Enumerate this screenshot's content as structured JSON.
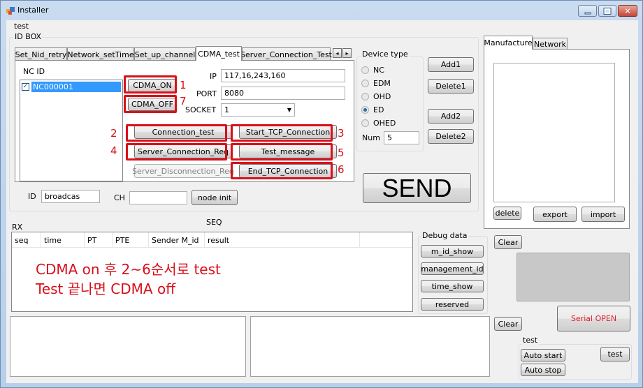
{
  "window": {
    "title": "Installer",
    "menu_label": "test"
  },
  "id_box": {
    "title": "ID BOX",
    "tabs": [
      {
        "label": "Set_Nid_retry",
        "active": false
      },
      {
        "label": "Network_setTime",
        "active": false
      },
      {
        "label": "Set_up_channel",
        "active": false
      },
      {
        "label": "CDMA_test",
        "active": true
      },
      {
        "label": "Server_Connection_Test",
        "active": false
      }
    ],
    "tab_scroll": {
      "left": "◂",
      "right": "▸"
    },
    "nc_id": {
      "label": "NC ID",
      "items": [
        {
          "label": "NC000001",
          "checked": true,
          "selected": true
        }
      ]
    },
    "cdma": {
      "cdma_on": "CDMA_ON",
      "cdma_off": "CDMA_OFF",
      "ip_label": "IP",
      "ip_value": "117,16,243,160",
      "port_label": "PORT",
      "port_value": "8080",
      "socket_label": "SOCKET",
      "socket_value": "1",
      "connection_test": "Connection_test",
      "start_tcp": "Start_TCP_Connection",
      "server_conn_req": "Server_Connection_Req",
      "test_message": "Test_message",
      "server_disconn_req": "Server_Disconnection_Req",
      "end_tcp": "End_TCP_Connection"
    },
    "step_numbers": {
      "cdma_on": "1",
      "cdma_off": "7",
      "connection_test": "2",
      "start_tcp": "3",
      "server_conn_req": "4",
      "test_message": "5",
      "end_tcp": "6"
    },
    "id_label": "ID",
    "id_value": "broadcas",
    "ch_label": "CH",
    "ch_value": "",
    "node_init": "node init",
    "device_type": {
      "title": "Device type",
      "options": [
        {
          "label": "NC",
          "checked": false
        },
        {
          "label": "EDM",
          "checked": false
        },
        {
          "label": "OHD",
          "checked": false
        },
        {
          "label": "ED",
          "checked": true
        },
        {
          "label": "OHED",
          "checked": false
        }
      ],
      "num_label": "Num",
      "num_value": "5"
    },
    "add1": "Add1",
    "delete1": "Delete1",
    "add2": "Add2",
    "delete2": "Delete2",
    "send": "SEND"
  },
  "right_panel": {
    "tabs": [
      {
        "label": "Manufacture",
        "active": true
      },
      {
        "label": "Network",
        "active": false
      }
    ],
    "delete": "delete",
    "export": "export",
    "import": "import"
  },
  "rx": {
    "label": "RX",
    "seq_label": "SEQ",
    "columns": [
      "seq",
      "time",
      "PT",
      "PTE",
      "Sender M_id",
      "result",
      ""
    ],
    "annotation_line1": "CDMA on 후 2~6순서로 test",
    "annotation_line2": "Test 끝나면 CDMA off"
  },
  "debug": {
    "title": "Debug data",
    "buttons": [
      "m_id_show",
      "management_id",
      "time_show",
      "reserved"
    ]
  },
  "clear1": "Clear",
  "clear2": "Clear",
  "serial_open": "Serial OPEN",
  "test_group": {
    "title": "test",
    "auto_start": "Auto start",
    "auto_stop": "Auto stop",
    "test": "test"
  },
  "colors": {
    "highlight": "#d8101a",
    "selection": "#3399ff",
    "serial_open_text": "#e0202a"
  }
}
